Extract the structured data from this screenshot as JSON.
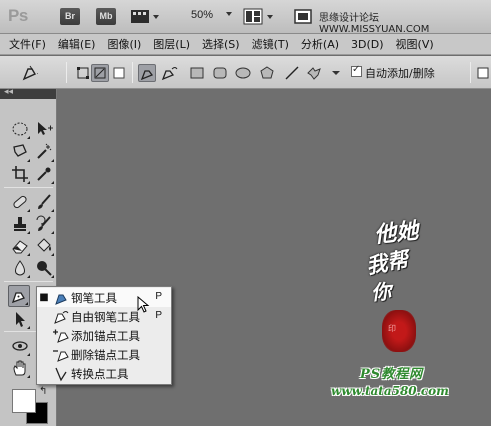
{
  "appbar": {
    "logo": "Ps",
    "buttons": [
      "Br",
      "Mb"
    ],
    "zoom": "50%",
    "site_title": "思缘设计论坛 WWW.MISSYUAN.COM"
  },
  "menu": [
    "文件(F)",
    "编辑(E)",
    "图像(I)",
    "图层(L)",
    "选择(S)",
    "滤镜(T)",
    "分析(A)",
    "3D(D)",
    "视图(V)"
  ],
  "options": {
    "auto_add_delete_label": "自动添加/删除",
    "auto_add_delete_checked": true
  },
  "toolpanel": {
    "header": "◂◂"
  },
  "flyout": {
    "items": [
      {
        "label": "钢笔工具",
        "shortcut": "P",
        "current": true
      },
      {
        "label": "自由钢笔工具",
        "shortcut": "P",
        "current": false
      },
      {
        "label": "添加锚点工具",
        "shortcut": "",
        "current": false
      },
      {
        "label": "删除锚点工具",
        "shortcut": "",
        "current": false
      },
      {
        "label": "转换点工具",
        "shortcut": "",
        "current": false
      }
    ]
  },
  "watermark": {
    "calligraphy_1": "他她",
    "calligraphy_2": "我帮",
    "calligraphy_3": "你",
    "seal_text": "印",
    "tutorial_text": "PS教程网",
    "url": "www.tata580.com"
  },
  "colors": {
    "foreground": "#ffffff",
    "background": "#000000",
    "canvas": "#6f6f6f",
    "brand_green": "#2f8a2f"
  }
}
